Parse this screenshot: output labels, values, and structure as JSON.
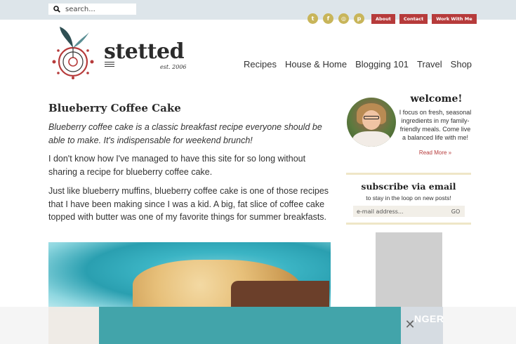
{
  "topbar": {
    "search_placeholder": "search...",
    "social": [
      "t",
      "f",
      "◎",
      "p"
    ],
    "links": [
      "About",
      "Contact",
      "Work With Me"
    ]
  },
  "header": {
    "brand": "stetted",
    "tagline": "est. 2006",
    "nav": [
      "Recipes",
      "House & Home",
      "Blogging 101",
      "Travel",
      "Shop"
    ]
  },
  "article": {
    "title": "Blueberry Coffee Cake",
    "intro": "Blueberry coffee cake is a classic breakfast recipe everyone should be able to make. It's indispensable for weekend brunch!",
    "p1": "I don't know how I've managed to have this site for so long without sharing a recipe for blueberry coffee cake.",
    "p2": "Just like blueberry muffins, blueberry coffee cake is one of those recipes that I have been making since I was a kid. A big, fat slice of coffee cake topped with butter was one of my favorite things for summer breakfasts."
  },
  "sidebar": {
    "welcome_title": "welcome!",
    "welcome_text": "I focus on fresh, seasonal ingredients in my family-friendly meals. Come live a balanced life with me!",
    "read_more": "Read More »",
    "subscribe_title": "subscribe via email",
    "subscribe_text": "to stay in the loop on new posts!",
    "email_placeholder": "e-mail address...",
    "go_label": "GO"
  },
  "adbar": {
    "text": "NGER",
    "close": "✕"
  },
  "colors": {
    "accent_red": "#b63b3b",
    "social_gold": "#c8b55a",
    "topbar_bg": "#dde5ea",
    "ad_teal": "#42a4aa"
  }
}
